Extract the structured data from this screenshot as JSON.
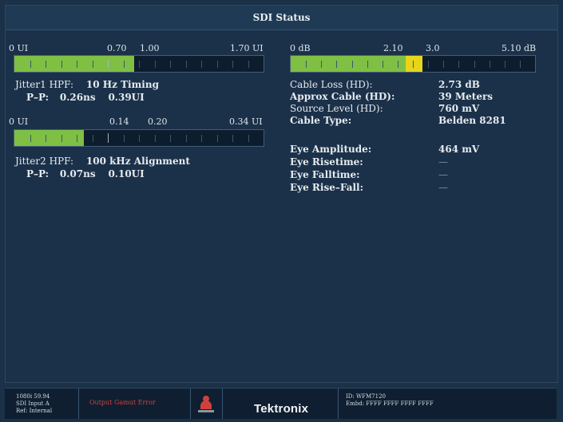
{
  "title": "SDI Status",
  "jitter1": {
    "scale": [
      "0 UI",
      "0.70",
      "1.00",
      "1.70 UI"
    ],
    "level": 0.48,
    "hpf_label": "Jitter1 HPF:",
    "hpf_value": "10 Hz Timing",
    "pp_label": "P–P:",
    "pp_ns": "0.26ns",
    "pp_ui": "0.39UI"
  },
  "jitter2": {
    "scale": [
      "0 UI",
      "0.14",
      "0.20",
      "0.34 UI"
    ],
    "level": 0.28,
    "hpf_label": "Jitter2 HPF:",
    "hpf_value": "100 kHz Alignment",
    "pp_label": "P–P:",
    "pp_ns": "0.07ns",
    "pp_ui": "0.10UI"
  },
  "cable_meter": {
    "scale": [
      "0 dB",
      "2.10",
      "3.0",
      "5.10 dB"
    ],
    "green_level": 0.47,
    "yellow_level": 0.54
  },
  "cable": {
    "loss_label": "Cable Loss (HD):",
    "loss_value": "2.73 dB",
    "approx_label": "Approx Cable (HD):",
    "approx_value": "39 Meters",
    "source_label": "Source Level (HD):",
    "source_value": "760 mV",
    "type_label": "Cable Type:",
    "type_value": "Belden 8281"
  },
  "eye": {
    "amp_label": "Eye Amplitude:",
    "amp_value": "464 mV",
    "rise_label": "Eye Risetime:",
    "rise_value": "—",
    "fall_label": "Eye Falltime:",
    "fall_value": "—",
    "risefall_label": "Eye Rise–Fall:",
    "risefall_value": "—"
  },
  "statusbar": {
    "line1": "1080i 59.94",
    "line2": "SDI Input A",
    "line3": "Ref: Internal",
    "error": "Output Gamut Error",
    "alarm_icon": "alarm-bell-icon",
    "logo": "Tektronix",
    "id_line": "ID: WFM7120",
    "embed_line": "Embd: FFFF FFFF FFFF FFFF"
  },
  "colors": {
    "green": "#7fbf44",
    "yellow": "#e6d51b",
    "error_red": "#d0413b"
  }
}
